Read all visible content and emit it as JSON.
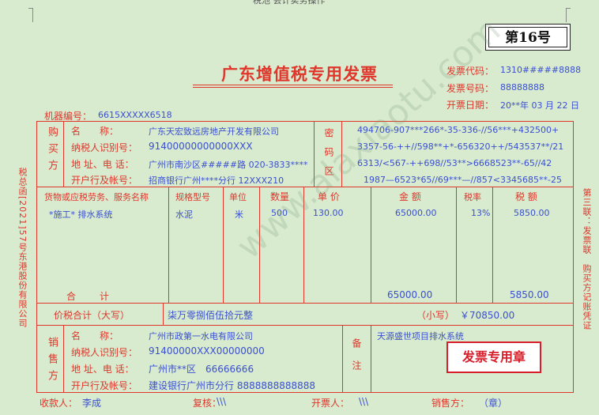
{
  "header_fragment": "税池 会计实务操作",
  "page_number": "第16号",
  "title": "广东增值税专用发票",
  "invoice_code_label": "发票代码：",
  "invoice_code": "1310#####8888",
  "invoice_number_label": "发票号码：",
  "invoice_number": "88888888",
  "invoice_date_label": "开票日期：",
  "invoice_date": "20**年 03 月 22 日",
  "machine_label": "机器编号：",
  "machine_number": "6615XXXXX6518",
  "buyer": {
    "section_label": "购买方",
    "name_label": "名　　称：",
    "name": "广东天宏致远房地产开发有限公司",
    "taxid_label": "纳税人识别号：",
    "taxid": "91400000000000XXX",
    "address_label": "地 址、电 话：",
    "address": "广州市南沙区#####路 020-3833****",
    "bank_label": "开户行及帐号：",
    "bank": "招商银行广州****分行 12XXX210"
  },
  "cipher": {
    "section_label": "密码区",
    "lines": [
      "494706-907***266*-35-336-//56***+432500+",
      "3357-56-++//598**+*-656320++/543537**/21",
      "6313/<567-++698//53**>6668523**-65//42",
      "1987—6523*65//69***—//857<3345685**-25"
    ]
  },
  "items_header": {
    "name": "货物或应税劳务、服务名称",
    "spec": "规格型号",
    "unit": "单位",
    "qty": "数量",
    "price": "单  价",
    "amount": "金  额",
    "rate": "税率",
    "tax": "税  额"
  },
  "items": [
    {
      "name": "*施工* 排水系统",
      "spec": "水泥",
      "unit": "米",
      "qty": "500",
      "price": "130.00",
      "amount": "65000.00",
      "rate": "13%",
      "tax": "5850.00"
    }
  ],
  "totals": {
    "label": "合　　计",
    "amount": "65000.00",
    "tax": "5850.00"
  },
  "grand_total": {
    "label": "价税合计（大写）",
    "upper": "柒万零捌佰伍拾元整",
    "small_label": "（小写）",
    "small": "￥70850.00"
  },
  "seller": {
    "section_label": "销售方",
    "name_label": "名　　称：",
    "name": "广州市政第一水电有限公司",
    "taxid_label": "纳税人识别号：",
    "taxid": "91400000XXX00000000",
    "address_label": "地 址、电 话：",
    "address": "广州市**区　66666666",
    "bank_label": "开户行及帐号：",
    "bank": "建设银行广州市分行 8888888888888"
  },
  "remarks": {
    "label": "备注",
    "text": "天源盛世项目排水系统"
  },
  "stamp_text": "发票专用章",
  "footer": {
    "payee_label": "收款人：",
    "payee": "李成",
    "review_label": "复核：",
    "review": "\\\\\\",
    "issuer_label": "开票人：",
    "issuer": "\\\\\\",
    "seller_label": "销售方：",
    "seller": "（章）"
  },
  "left_side_text": "税总函[2021]57号东港股份有限公司",
  "right_side_text": "第三联：发票联　购买方记账凭证",
  "watermark": "www.alaxiaotu.com"
}
